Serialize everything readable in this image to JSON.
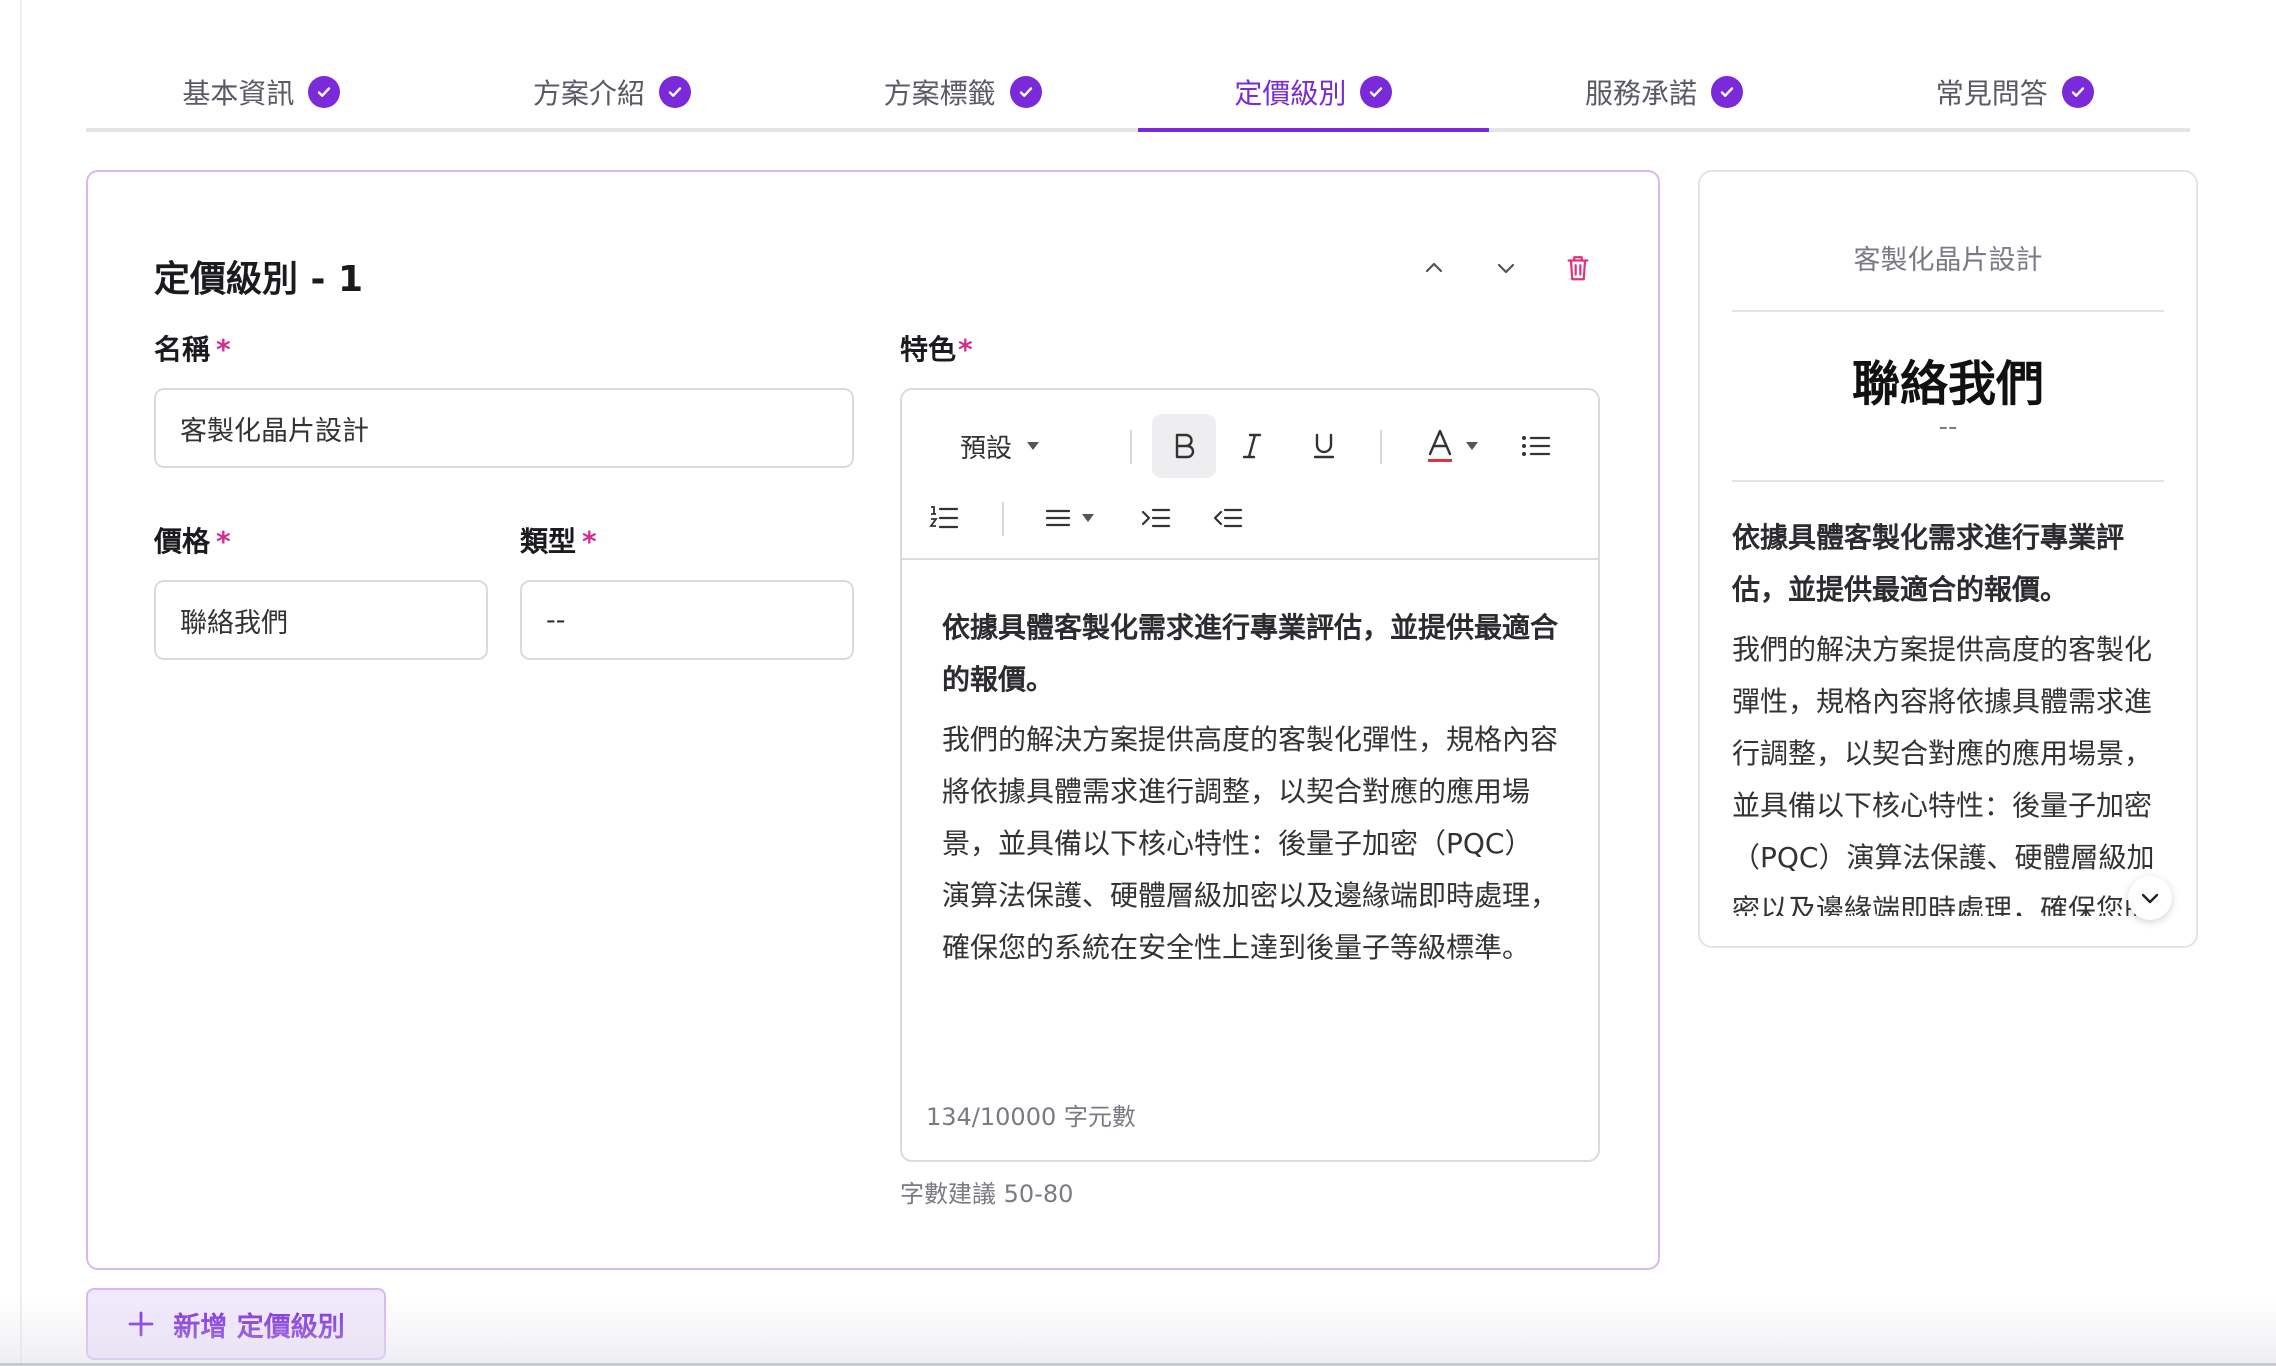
{
  "tabs": [
    {
      "label": "基本資訊",
      "done": true
    },
    {
      "label": "方案介紹",
      "done": true
    },
    {
      "label": "方案標籤",
      "done": true
    },
    {
      "label": "定價級別",
      "done": true,
      "active": true
    },
    {
      "label": "服務承諾",
      "done": true
    },
    {
      "label": "常見問答",
      "done": true
    }
  ],
  "tier": {
    "title": "定價級別 - 1",
    "name_label": "名稱",
    "name_value": "客製化晶片設計",
    "price_label": "價格",
    "price_value": "聯絡我們",
    "type_label": "類型",
    "type_value": "--",
    "features_label": "特色",
    "required_mark": "*"
  },
  "editor": {
    "style_select": "預設",
    "lead": "依據具體客製化需求進行專業評估，並提供最適合的報價。",
    "body": "我們的解決方案提供高度的客製化彈性，規格內容將依據具體需求進行調整，以契合對應的應用場景，並具備以下核心特性：後量子加密（PQC）演算法保護、硬體層級加密以及邊緣端即時處理，確保您的系統在安全性上達到後量子等級標準。",
    "char_count": "134/10000 字元數",
    "hint": "字數建議 50-80"
  },
  "preview": {
    "plan_name": "客製化晶片設計",
    "price": "聯絡我們",
    "type": "--",
    "lead": "依據具體客製化需求進行專業評估，並提供最適合的報價。",
    "body": "我們的解決方案提供高度的客製化彈性，規格內容將依據具體需求進行調整，以契合對應的應用場景，並具備以下核心特性：後量子加密（PQC）演算法保護、硬體層級加密以及邊緣端即時處理，確保您的系統在安全性上達到後量子等級標準。"
  },
  "add_button": {
    "label": "新增 定價級別"
  },
  "colors": {
    "accent": "#7a2ad8",
    "required": "#d42c8c",
    "border_active": "#d7b8f3",
    "delete": "#e0337f"
  }
}
